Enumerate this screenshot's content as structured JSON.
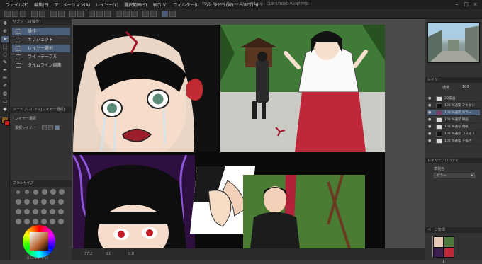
{
  "app": {
    "window_title": "TSUJI_Shiraki_Rai_ep_Chap_14.clip - CLIP STUDIO PAINT PRO"
  },
  "menu": [
    "ファイル(F)",
    "編集(E)",
    "アニメーション(A)",
    "レイヤー(L)",
    "選択範囲(S)",
    "表示(V)",
    "フィルター(I)",
    "ウィンドウ(W)",
    "ヘルプ(H)"
  ],
  "subtool_panel": {
    "header": "サブツール[操作]",
    "items": [
      {
        "label": "操作",
        "selected": true
      },
      {
        "label": "オブジェクト",
        "selected": false
      },
      {
        "label": "レイヤー選択",
        "selected": true
      },
      {
        "label": "ライトテーブル",
        "selected": false
      },
      {
        "label": "タイムライン編集",
        "selected": false
      }
    ]
  },
  "tool_property": {
    "header": "ツールプロパティ[レイヤー選択]",
    "row1": "レイヤー選択",
    "row2": "選択レイヤー"
  },
  "brush_panel": {
    "header": "ブラシサイズ"
  },
  "color": {
    "main": "#8a5a1c",
    "sub": "#c0201f",
    "values": "H 23  S 81  V 54"
  },
  "status": {
    "zoom": "37.2",
    "rotation": "0.0",
    "coords": "0.0"
  },
  "layers_panel": {
    "header": "レイヤー",
    "blend": "通常",
    "opacity": "100",
    "rows": [
      {
        "label": "3D描画",
        "selected": false
      },
      {
        "label": "100 %通常  フキダシ",
        "selected": false
      },
      {
        "label": "100 %通常  カラー",
        "selected": true
      },
      {
        "label": "100 %通常  線画",
        "selected": false
      },
      {
        "label": "100 %通常  用紙",
        "selected": false
      },
      {
        "label": "100 %通常  コマ枠 1",
        "selected": false
      },
      {
        "label": "100 %通常  下描き",
        "selected": false
      }
    ]
  },
  "layer_property": {
    "header": "レイヤープロパティ",
    "label": "表現色",
    "value": "カラー"
  },
  "page_manager": {
    "header": "ページ管理",
    "page_label": "1"
  },
  "icons": {
    "minimize": "minimize-icon",
    "maximize": "maximize-icon",
    "close": "close-icon"
  }
}
